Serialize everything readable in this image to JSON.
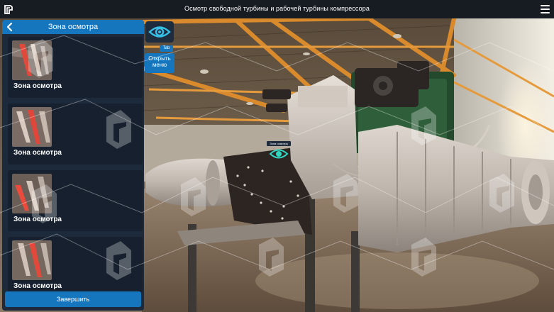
{
  "app": {
    "title": "Осмотр свободной турбины и рабочей турбины компрессора"
  },
  "panel": {
    "title": "Зона осмотра",
    "cards": [
      {
        "label": "Зона осмотра"
      },
      {
        "label": "Зона осмотра"
      },
      {
        "label": "Зона осмотра"
      },
      {
        "label": "Зона осмотра"
      }
    ],
    "finish_label": "Завершить"
  },
  "view_controls": {
    "tab_hint": "Tab",
    "open_menu_line1": "Открыть",
    "open_menu_line2": "меню"
  },
  "scene": {
    "zone_marker_label": "Зона осмотра"
  },
  "colors": {
    "accent": "#1676bd",
    "panel_bg": "#1d2a3c",
    "card_bg": "#16202e",
    "eye_icon": "#37c0e6",
    "marker_icon": "#2fd6c0",
    "hangar_beam": "#d98a2c"
  },
  "icons": {
    "logo": "app-logo-icon",
    "menu": "hamburger-menu-icon",
    "back": "chevron-left-icon",
    "eye": "eye-icon"
  }
}
